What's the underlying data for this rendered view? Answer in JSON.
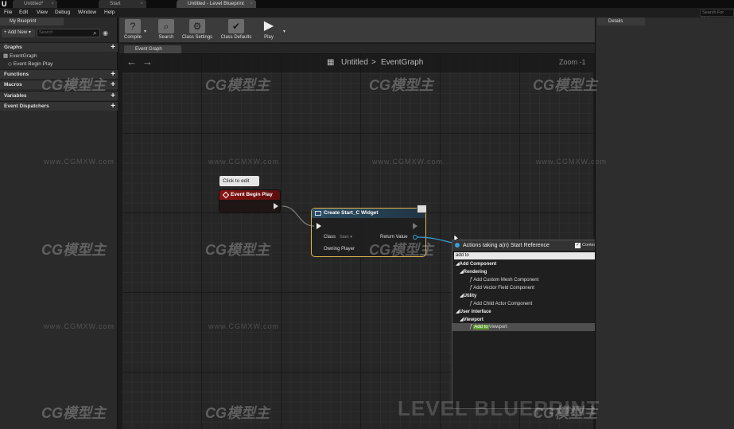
{
  "titlebar": {
    "logo": "U",
    "tabs": [
      {
        "label": "Untitled*"
      },
      {
        "label": "Start"
      },
      {
        "label": "Untitled - Level Blueprint"
      }
    ]
  },
  "menubar": {
    "items": [
      "File",
      "Edit",
      "View",
      "Debug",
      "Window",
      "Help"
    ],
    "search_help_placeholder": "Search For Help"
  },
  "left_panel": {
    "tab_label": "My Blueprint",
    "add_new_label": "+ Add New ▾",
    "search_placeholder": "Search",
    "sections": {
      "graphs": "Graphs",
      "functions": "Functions",
      "macros": "Macros",
      "variables": "Variables",
      "event_dispatchers": "Event Dispatchers"
    },
    "tree": {
      "event_graph": "EventGraph",
      "event_begin_play": "Event Begin Play"
    }
  },
  "toolbar": {
    "compile": "Compile",
    "search": "Search",
    "class_settings": "Class Settings",
    "class_defaults": "Class Defaults",
    "play": "Play"
  },
  "graph_tab": {
    "label": "Event Graph"
  },
  "graph": {
    "breadcrumb_root": "Untitled",
    "breadcrumb_sep": ">",
    "breadcrumb_leaf": "EventGraph",
    "zoom": "Zoom -1"
  },
  "nodes": {
    "tooltip": "Click to edit",
    "event_begin_play": "Event Begin Play",
    "create_widget": {
      "title": "Create Start_C Widget",
      "class_label": "Class",
      "class_value": "Start ▾",
      "owning_player": "Owning Player",
      "return_value": "Return Value"
    }
  },
  "action_menu": {
    "title": "Actions taking a(n) Start Reference",
    "context_sensitive": "Context Sensitive",
    "search_value": "add to",
    "items": [
      {
        "label": "Add Component",
        "type": "cat",
        "prefix": "◢"
      },
      {
        "label": "Rendering",
        "type": "cat",
        "prefix": "◢"
      },
      {
        "label": "Add Custom Mesh Component",
        "type": "fn"
      },
      {
        "label": "Add Vector Field Component",
        "type": "fn"
      },
      {
        "label": "Utility",
        "type": "cat",
        "prefix": "◢"
      },
      {
        "label": "Add Child Actor Component",
        "type": "fn"
      },
      {
        "label": "User Interface",
        "type": "cat",
        "prefix": "◢"
      },
      {
        "label": "Viewport",
        "type": "cat",
        "prefix": "◢"
      },
      {
        "label": "Viewport",
        "type": "fn",
        "highlight": "Add to"
      }
    ]
  },
  "details": {
    "tab_label": "Details"
  },
  "watermarks": {
    "brand": "CG模型主",
    "url": "www.CGMXW.com",
    "big": "LEVEL BLUEPRINT"
  },
  "colors": {
    "event_node_header": "#8a1414",
    "widget_node_header": "#2d4e63",
    "selection_outline": "#e2b64a",
    "object_pin": "#3aa0d8",
    "search_highlight": "#5e9c2e"
  }
}
